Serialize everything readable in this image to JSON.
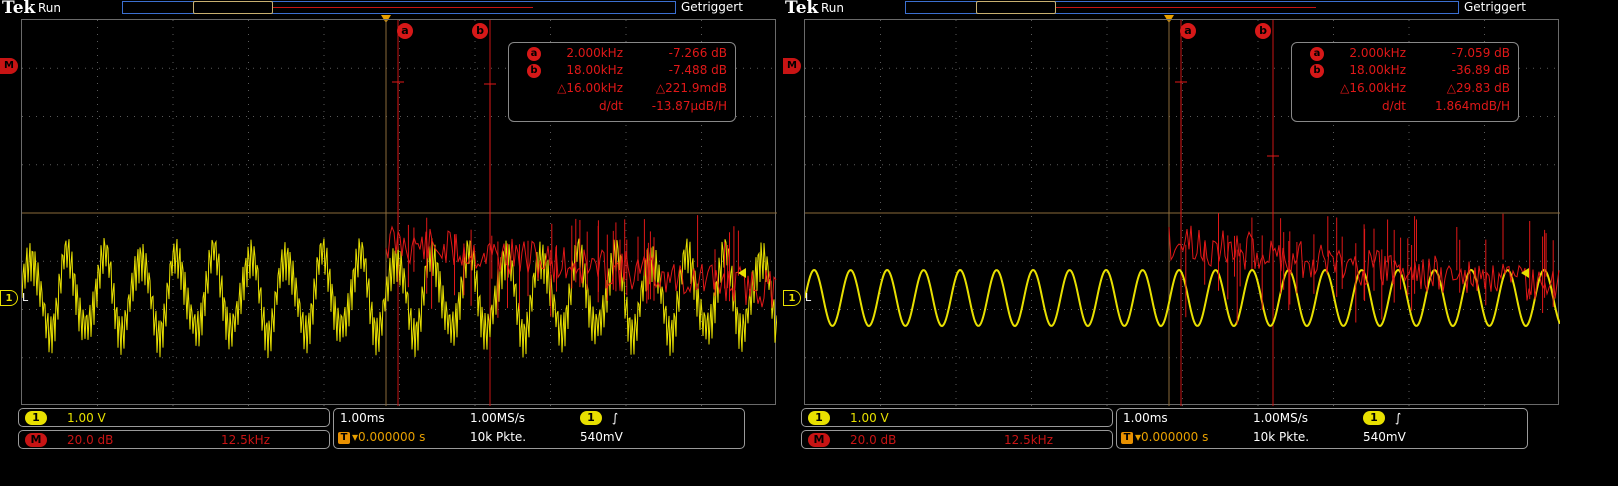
{
  "screens": [
    {
      "brand": "Tek",
      "state": "Run",
      "trigger_status": "Getriggert",
      "cursor_a_label": "a",
      "cursor_b_label": "b",
      "readout": {
        "a_freq": "2.000kHz",
        "a_val": "-7.266 dB",
        "b_freq": "18.00kHz",
        "b_val": "-7.488 dB",
        "delta_freq": "△16.00kHz",
        "delta_val": "△221.9mdB",
        "ddt_label": "d/dt",
        "ddt_val": "-13.87µdB/H"
      },
      "ch1": {
        "badge": "1",
        "scale": "1.00 V"
      },
      "math": {
        "badge": "M",
        "scale": "20.0 dB",
        "span": "12.5kHz"
      },
      "timebase": {
        "scale": "1.00ms",
        "rate": "1.00MS/s",
        "pos": "▾0.000000 s",
        "points": "10k Pkte."
      },
      "trig": {
        "badge": "1",
        "slope": "∫",
        "level": "540mV",
        "tbadge": "T"
      },
      "marker_m": "M",
      "marker_1": "1",
      "marker_L": "L"
    },
    {
      "brand": "Tek",
      "state": "Run",
      "trigger_status": "Getriggert",
      "cursor_a_label": "a",
      "cursor_b_label": "b",
      "readout": {
        "a_freq": "2.000kHz",
        "a_val": "-7.059 dB",
        "b_freq": "18.00kHz",
        "b_val": "-36.89 dB",
        "delta_freq": "△16.00kHz",
        "delta_val": "△29.83 dB",
        "ddt_label": "d/dt",
        "ddt_val": "1.864mdB/H"
      },
      "ch1": {
        "badge": "1",
        "scale": "1.00 V"
      },
      "math": {
        "badge": "M",
        "scale": "20.0 dB",
        "span": "12.5kHz"
      },
      "timebase": {
        "scale": "1.00ms",
        "rate": "1.00MS/s",
        "pos": "▾0.000000 s",
        "points": "10k Pkte."
      },
      "trig": {
        "badge": "1",
        "slope": "∫",
        "level": "540mV",
        "tbadge": "T"
      },
      "marker_m": "M",
      "marker_1": "1",
      "marker_L": "L"
    }
  ],
  "colors": {
    "ch1": "#e8e000",
    "math": "#e01818",
    "grid": "#5a5a5a",
    "trigger": "#e8a000"
  }
}
